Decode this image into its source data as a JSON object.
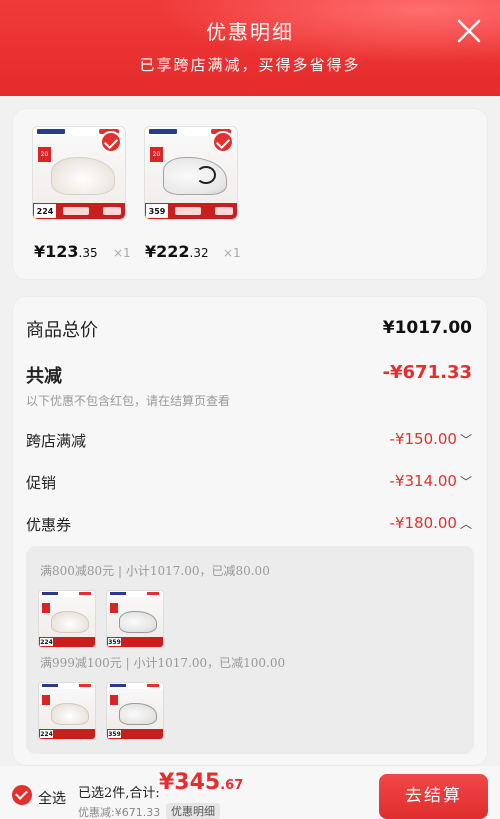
{
  "header": {
    "title": "优惠明细",
    "subtitle": "已享跨店满减，买得多省得多"
  },
  "products": [
    {
      "thumb_price": "224",
      "price_int": "¥123",
      "price_dec": ".35",
      "qty": "×1"
    },
    {
      "thumb_price": "359",
      "price_int": "¥222",
      "price_dec": ".32",
      "qty": "×1"
    }
  ],
  "summary": {
    "total_label": "商品总价",
    "total_value": "¥1017.00",
    "discount_label": "共减",
    "discount_value": "-¥671.33",
    "note": "以下优惠不包含红包，请在结算页查看",
    "rows": [
      {
        "label": "跨店满减",
        "value": "-¥150.00",
        "chevron": "chevron-down-icon"
      },
      {
        "label": "促销",
        "value": "-¥314.00",
        "chevron": "chevron-down-icon"
      },
      {
        "label": "优惠券",
        "value": "-¥180.00",
        "chevron": "chevron-up-icon"
      }
    ]
  },
  "coupons": [
    {
      "text": "满800减80元 | 小计1017.00，已减80.00",
      "thumbs": [
        "224",
        "359"
      ]
    },
    {
      "text": "满999减100元 | 小计1017.00，已减100.00",
      "thumbs": [
        "224",
        "359"
      ]
    }
  ],
  "footer": {
    "select_all": "全选",
    "selected_text": "已选2件,合计:",
    "total_int": "¥345",
    "total_dec": ".67",
    "discount_text": "优惠减:¥671.33",
    "detail_link": "优惠明细",
    "checkout": "去结算"
  },
  "colors": {
    "accent": "#e3302f",
    "header_bg": "#ea2f2f"
  }
}
